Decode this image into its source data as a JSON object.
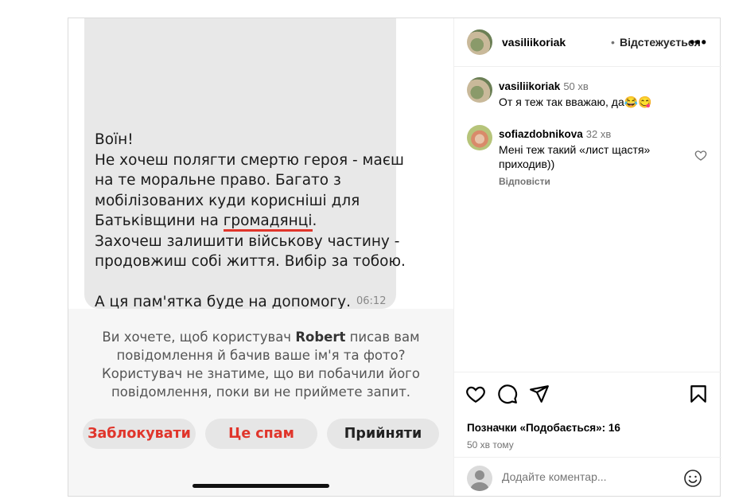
{
  "message": {
    "lines": [
      "Воїн!",
      "Не хочеш полягти смертю героя - маєш",
      "на те моральне право. Багато з",
      "мобілізованих куди корисніші для",
      "Батьківщини на ",
      "громадянці",
      ".",
      "Захочеш залишити військову частину -",
      "продовжиш собі життя. Вибір за тобою.",
      "А ця пам'ятка буде на допомогу."
    ],
    "time": "06:12"
  },
  "request": {
    "text_before": "Ви хочете, щоб користувач ",
    "user": "Robert",
    "text_after": " писав вам повідомлення й бачив ваше ім'я та фото? Користувач не знатиме, що ви побачили його повідомлення, поки ви не приймете запит.",
    "block_label": "Заблокувати",
    "spam_label": "Це спам",
    "accept_label": "Прийняти"
  },
  "header": {
    "username": "vasiliikoriak",
    "separator": "•",
    "follow_status": "Відстежується",
    "more_icon": "more-horizontal-icon"
  },
  "comments": [
    {
      "username": "vasiliikoriak",
      "time": "50 хв",
      "text": "От я теж так вважаю, да😂😋"
    },
    {
      "username": "sofiazdobnikova",
      "time": "32 хв",
      "text": "Мені теж такий «лист щастя» приходив))",
      "reply": "Відповісти"
    }
  ],
  "actions": {
    "likes": "Позначки «Подобається»: 16",
    "ago": "50 хв тому",
    "comment_placeholder": "Додайте коментар..."
  },
  "colors": {
    "danger": "#e0352b",
    "muted": "#737373",
    "border": "#dbdbdb"
  }
}
